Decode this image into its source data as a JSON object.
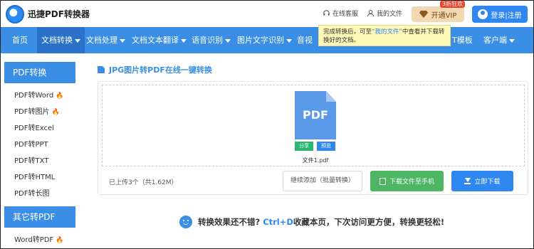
{
  "header": {
    "logo_text": "迅捷PDF转换器",
    "online_service": "在线客服",
    "my_files": "我的文件",
    "vip_label": "开通VIP",
    "vip_tag": "3折狂欢",
    "login_label": "登录|注册"
  },
  "nav": {
    "items": [
      {
        "label": "首页"
      },
      {
        "label": "文档转换"
      },
      {
        "label": "文档处理"
      },
      {
        "label": "文档文本翻译"
      },
      {
        "label": "语音识别"
      },
      {
        "label": "图片文字识别"
      },
      {
        "label": "音视"
      },
      {
        "label": "T模板"
      },
      {
        "label": "客户端"
      }
    ]
  },
  "tooltip": {
    "text_before": "完成转换后，可至",
    "link": "“我的文件”",
    "text_after": "中查看并下载转换好的文档。"
  },
  "sidebar": {
    "section1_title": "PDF转换",
    "section1_items": [
      {
        "label": "PDF转Word",
        "hot": true
      },
      {
        "label": "PDF转图片",
        "hot": true
      },
      {
        "label": "PDF转Excel",
        "hot": false
      },
      {
        "label": "PDF转PPT",
        "hot": false
      },
      {
        "label": "PDF转TXT",
        "hot": false
      },
      {
        "label": "PDF转HTML",
        "hot": false
      },
      {
        "label": "PDF转长图",
        "hot": false
      }
    ],
    "section2_title": "其它转PDF",
    "section2_items": [
      {
        "label": "Word转PDF",
        "hot": true
      }
    ]
  },
  "main": {
    "title": "JPG图片转PDF在线一键转换",
    "file_icon_label": "PDF",
    "share_label": "分享",
    "preview_label": "预览",
    "file_name": "文件1.pdf",
    "upload_info": "已上传3个（共1.62M）",
    "add_button": "继续添加（批量转换）",
    "phone_button": "下载文件至手机",
    "download_button": "立即下载"
  },
  "promo": {
    "text1": "转换效果还不错?",
    "hotkey": "Ctrl+D",
    "text2": "收藏本页，下次访问更方便，转换更轻松!"
  },
  "colors": {
    "brand_blue": "#3a8ee6",
    "green": "#4cb665",
    "vip_gold": "#f3d9b1"
  }
}
